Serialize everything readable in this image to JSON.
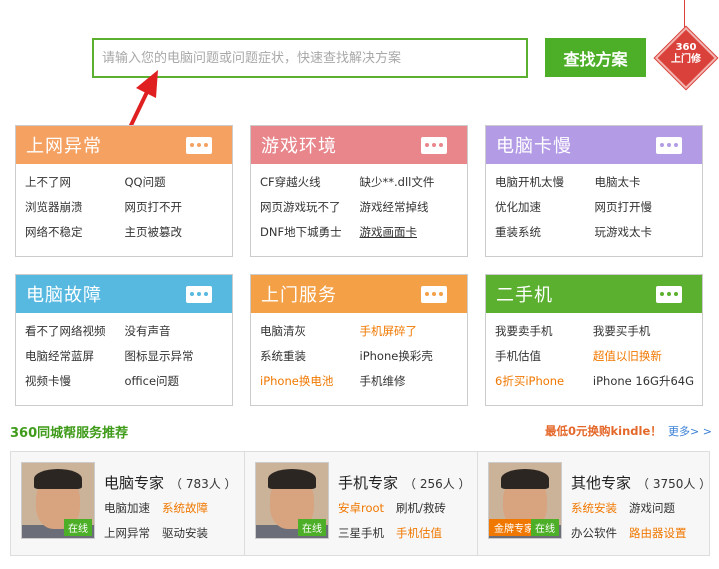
{
  "search": {
    "placeholder": "请输入您的电脑问题或问题症状，快速查找解决方案",
    "button": "查找方案"
  },
  "badge": {
    "line1": "360",
    "line2": "上门修"
  },
  "cards": [
    {
      "title": "上网异常",
      "color": "#f4a162",
      "items": [
        {
          "text": "上不了网",
          "style": ""
        },
        {
          "text": "QQ问题",
          "style": ""
        },
        {
          "text": "浏览器崩溃",
          "style": ""
        },
        {
          "text": "网页打不开",
          "style": ""
        },
        {
          "text": "网络不稳定",
          "style": ""
        },
        {
          "text": "主页被篡改",
          "style": ""
        }
      ]
    },
    {
      "title": "游戏环境",
      "color": "#e8868c",
      "items": [
        {
          "text": "CF穿越火线",
          "style": ""
        },
        {
          "text": "缺少**.dll文件",
          "style": ""
        },
        {
          "text": "网页游戏玩不了",
          "style": ""
        },
        {
          "text": "游戏经常掉线",
          "style": ""
        },
        {
          "text": "DNF地下城勇士",
          "style": ""
        },
        {
          "text": "游戏画面卡",
          "style": "ul"
        }
      ]
    },
    {
      "title": "电脑卡慢",
      "color": "#b39be6",
      "items": [
        {
          "text": "电脑开机太慢",
          "style": ""
        },
        {
          "text": "电脑太卡",
          "style": ""
        },
        {
          "text": "优化加速",
          "style": ""
        },
        {
          "text": "网页打开慢",
          "style": ""
        },
        {
          "text": "重装系统",
          "style": ""
        },
        {
          "text": "玩游戏太卡",
          "style": ""
        }
      ]
    },
    {
      "title": "电脑故障",
      "color": "#57b8e0",
      "items": [
        {
          "text": "看不了网络视频",
          "style": ""
        },
        {
          "text": "没有声音",
          "style": ""
        },
        {
          "text": "电脑经常蓝屏",
          "style": ""
        },
        {
          "text": "图标显示异常",
          "style": ""
        },
        {
          "text": "视频卡慢",
          "style": ""
        },
        {
          "text": "office问题",
          "style": ""
        }
      ]
    },
    {
      "title": "上门服务",
      "color": "#f4a046",
      "items": [
        {
          "text": "电脑清灰",
          "style": ""
        },
        {
          "text": "手机屏碎了",
          "style": "hl"
        },
        {
          "text": "系统重装",
          "style": ""
        },
        {
          "text": "iPhone换彩壳",
          "style": ""
        },
        {
          "text": "iPhone换电池",
          "style": "hl"
        },
        {
          "text": "手机维修",
          "style": ""
        }
      ]
    },
    {
      "title": "二手机",
      "color": "#5bb12f",
      "items": [
        {
          "text": "我要卖手机",
          "style": ""
        },
        {
          "text": "我要买手机",
          "style": ""
        },
        {
          "text": "手机估值",
          "style": ""
        },
        {
          "text": "超值以旧换新",
          "style": "hl"
        },
        {
          "text": "6折买iPhone",
          "style": "hl"
        },
        {
          "text": "iPhone 16G升64G",
          "style": ""
        }
      ]
    }
  ],
  "recommend": {
    "title": "360同城帮服务推荐",
    "promo": "最低0元换购kindle！",
    "more": "更多> >",
    "experts": [
      {
        "name": "电脑专家",
        "count": "（ 783人 ）",
        "status": "在线",
        "gold": "",
        "skills": [
          {
            "text": "电脑加速",
            "style": ""
          },
          {
            "text": "系统故障",
            "style": "hl"
          },
          {
            "text": "上网异常",
            "style": ""
          },
          {
            "text": "驱动安装",
            "style": ""
          }
        ]
      },
      {
        "name": "手机专家",
        "count": "（ 256人 ）",
        "status": "在线",
        "gold": "",
        "skills": [
          {
            "text": "安卓root",
            "style": "hl"
          },
          {
            "text": "刷机/救砖",
            "style": ""
          },
          {
            "text": "三星手机",
            "style": ""
          },
          {
            "text": "手机估值",
            "style": "hl"
          }
        ]
      },
      {
        "name": "其他专家",
        "count": "（ 3750人 ）",
        "status": "在线",
        "gold": "金牌专家",
        "skills": [
          {
            "text": "系统安装",
            "style": "hl"
          },
          {
            "text": "游戏问题",
            "style": ""
          },
          {
            "text": "办公软件",
            "style": ""
          },
          {
            "text": "路由器设置",
            "style": "hl"
          }
        ]
      }
    ]
  }
}
